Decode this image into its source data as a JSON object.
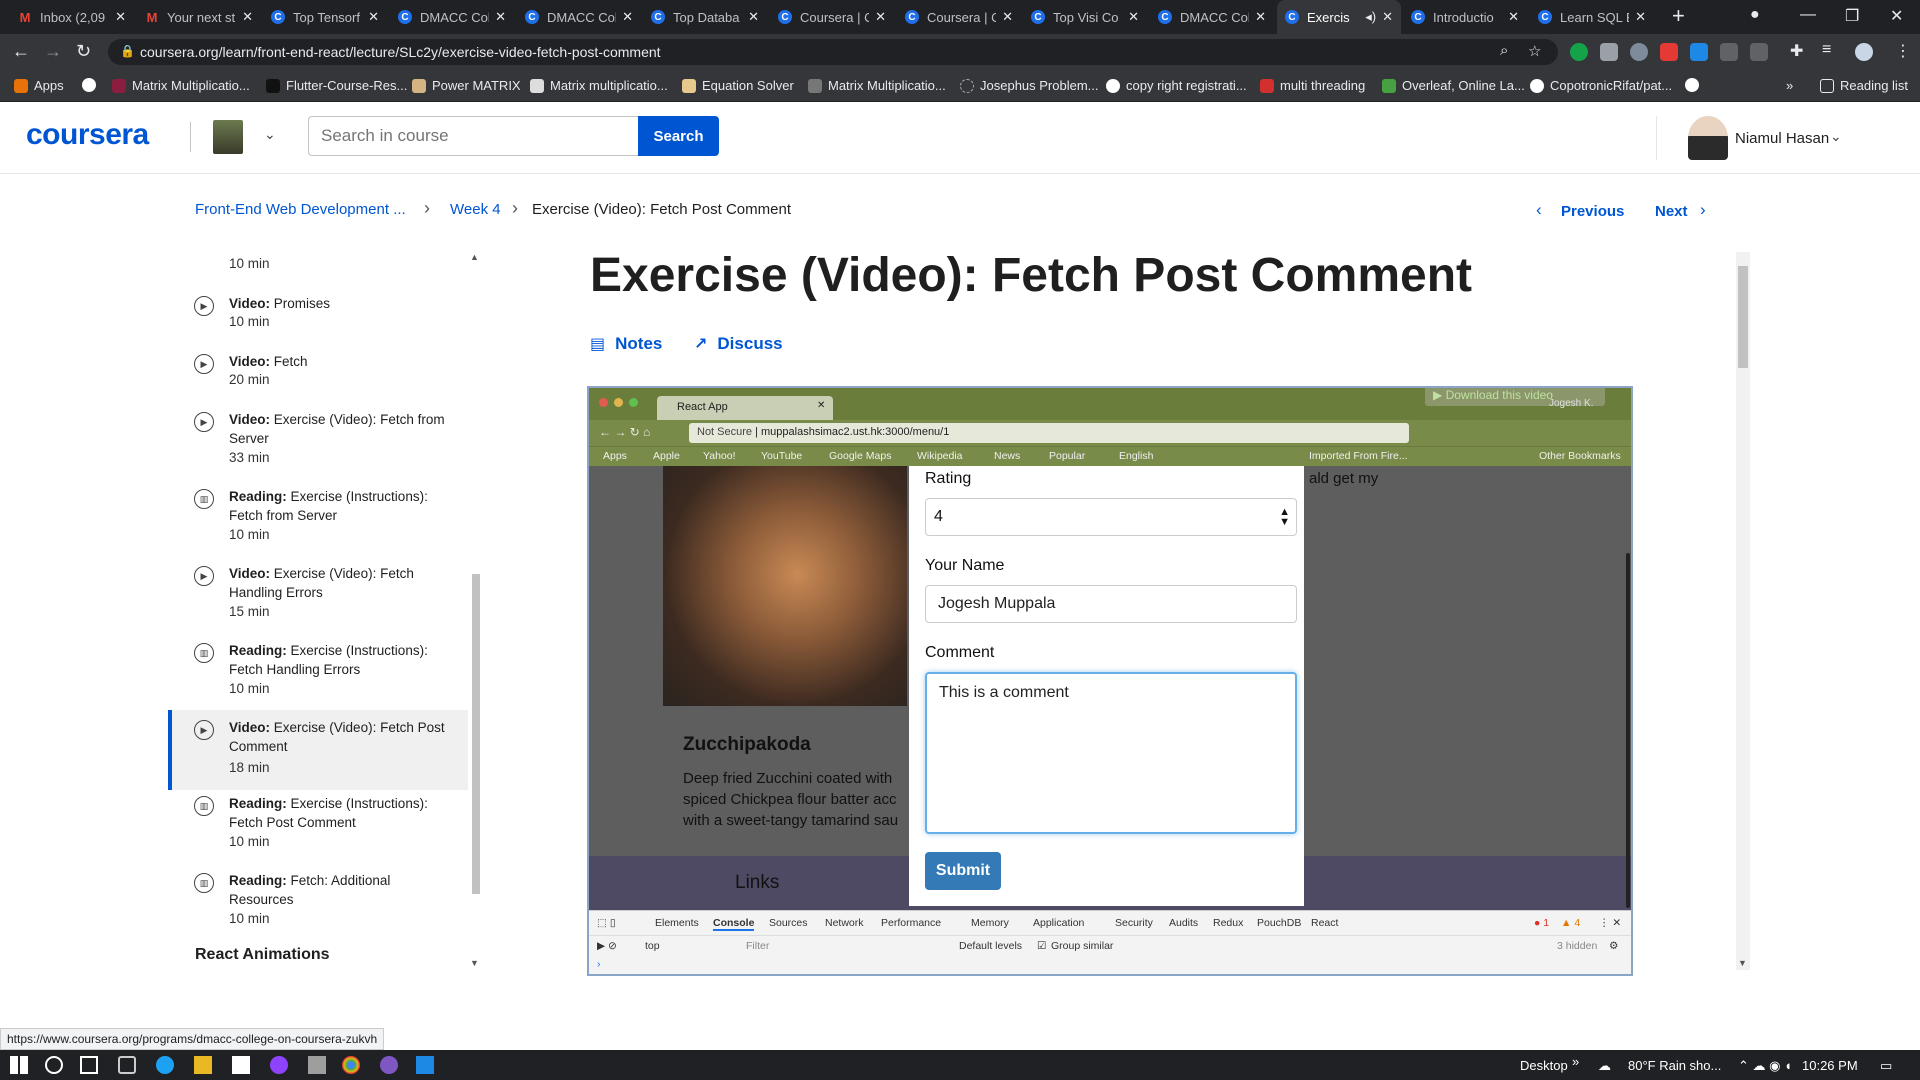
{
  "browser": {
    "tabs": [
      {
        "title": "Inbox (2,09",
        "icon": "gmail-icon"
      },
      {
        "title": "Your next st",
        "icon": "gmail-icon"
      },
      {
        "title": "Top Tensorf",
        "icon": "coursera-icon"
      },
      {
        "title": "DMACC Col",
        "icon": "coursera-icon"
      },
      {
        "title": "DMACC Col",
        "icon": "coursera-icon"
      },
      {
        "title": "Top Databa",
        "icon": "coursera-icon"
      },
      {
        "title": "Coursera | C",
        "icon": "coursera-icon"
      },
      {
        "title": "Coursera | C",
        "icon": "coursera-icon"
      },
      {
        "title": "Top Visi Co",
        "icon": "coursera-icon"
      },
      {
        "title": "DMACC Col",
        "icon": "coursera-icon"
      },
      {
        "title": "Exercis",
        "icon": "coursera-icon",
        "active": true
      },
      {
        "title": "Introductio",
        "icon": "coursera-icon"
      },
      {
        "title": "Learn SQL B",
        "icon": "coursera-icon"
      }
    ],
    "url": "coursera.org/learn/front-end-react/lecture/SLc2y/exercise-video-fetch-post-comment",
    "bookmarks": [
      "Apps",
      "Matrix Multiplicatio...",
      "Flutter-Course-Res...",
      "Power MATRIX",
      "Matrix multiplicatio...",
      "Equation Solver",
      "Matrix Multiplicatio...",
      "Josephus Problem...",
      "copy right registrati...",
      "multi threading",
      "Overleaf, Online La...",
      "CopotronicRifat/pat..."
    ],
    "reading_list": "Reading list",
    "status_url": "https://www.coursera.org/programs/dmacc-college-on-coursera-zukvh"
  },
  "header": {
    "logo": "coursera",
    "search_placeholder": "Search in course",
    "search_button": "Search",
    "user_name": "Niamul Hasan"
  },
  "breadcrumb": {
    "course": "Front-End Web Development ...",
    "week": "Week 4",
    "current": "Exercise (Video): Fetch Post Comment",
    "previous": "Previous",
    "next": "Next"
  },
  "sidebar": {
    "partial_duration": "10 min",
    "items": [
      {
        "type": "Video:",
        "title": "Promises",
        "duration": "10 min",
        "icon": "play-icon"
      },
      {
        "type": "Video:",
        "title": "Fetch",
        "duration": "20 min",
        "icon": "play-icon"
      },
      {
        "type": "Video:",
        "title": "Exercise (Video): Fetch from Server",
        "duration": "33 min",
        "icon": "play-icon"
      },
      {
        "type": "Reading:",
        "title": "Exercise (Instructions): Fetch from Server",
        "duration": "10 min",
        "icon": "book-icon"
      },
      {
        "type": "Video:",
        "title": "Exercise (Video): Fetch Handling Errors",
        "duration": "15 min",
        "icon": "play-icon"
      },
      {
        "type": "Reading:",
        "title": "Exercise (Instructions): Fetch Handling Errors",
        "duration": "10 min",
        "icon": "book-icon"
      },
      {
        "type": "Video:",
        "title": "Exercise (Video): Fetch Post Comment",
        "duration": "18 min",
        "icon": "play-icon",
        "active": true
      },
      {
        "type": "Reading:",
        "title": "Exercise (Instructions): Fetch Post Comment",
        "duration": "10 min",
        "icon": "book-icon"
      },
      {
        "type": "Reading:",
        "title": "Fetch: Additional Resources",
        "duration": "10 min",
        "icon": "book-icon"
      }
    ],
    "section": "React Animations"
  },
  "content": {
    "title": "Exercise (Video): Fetch Post Comment",
    "notes": "Notes",
    "discuss": "Discuss",
    "download": "Download this video"
  },
  "video": {
    "inner_tab": "React App",
    "inner_user": "Jogesh K.",
    "inner_url_secure": "Not Secure",
    "inner_url": "muppalashsimac2.ust.hk:3000/menu/1",
    "inner_bookmarks": [
      "Apps",
      "Apple",
      "Yahoo!",
      "YouTube",
      "Google Maps",
      "Wikipedia",
      "News",
      "Popular",
      "English",
      "Imported From Fire...",
      "Other Bookmarks"
    ],
    "dish_name": "Zucchipakoda",
    "dish_desc": "Deep fried Zucchini coated with spiced Chickpea flour batter acc with a sweet-tangy tamarind sau",
    "behind_text": "ald get my",
    "footer_links": "Links",
    "form": {
      "rating_label": "Rating",
      "rating_value": "4",
      "name_label": "Your Name",
      "name_value": "Jogesh Muppala",
      "comment_label": "Comment",
      "comment_value": "This is a comment",
      "submit": "Submit"
    },
    "devtools_tabs": [
      "Elements",
      "Console",
      "Sources",
      "Network",
      "Performance",
      "Memory",
      "Application",
      "Security",
      "Audits",
      "Redux",
      "PouchDB",
      "React"
    ],
    "devtools_context": "top",
    "devtools_filter": "Filter",
    "devtools_levels": "Default levels",
    "devtools_group": "Group similar",
    "devtools_hidden": "3 hidden",
    "devtools_errors": "1",
    "devtools_warnings": "4"
  },
  "taskbar": {
    "desktop": "Desktop",
    "weather": "80°F  Rain sho...",
    "time": "10:26 PM"
  }
}
